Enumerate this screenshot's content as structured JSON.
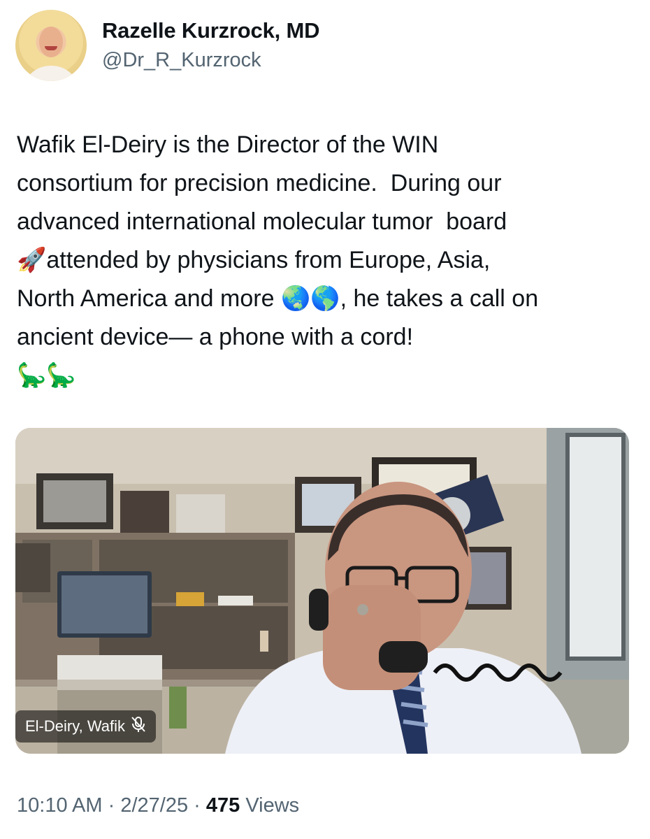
{
  "author": {
    "display_name": "Razelle Kurzrock, MD",
    "handle": "@Dr_R_Kurzrock",
    "avatar_icon": "profile-photo"
  },
  "tweet": {
    "line1": "Wafik El-Deiry is the Director of the WIN",
    "line2": "consortium for precision medicine.  During our",
    "line3": "advanced international molecular tumor  board",
    "line4_emoji": "🚀",
    "line4": "attended by physicians from Europe, Asia,",
    "line5a": "North America and more",
    "line5_emoji": "🌏🌎",
    "line5b": ", he takes a call on",
    "line6": "ancient device— a phone with a cord!",
    "line7_emoji": "🦕🦕"
  },
  "media": {
    "participant_label": "El-Deiry, Wafik",
    "muted_icon": "mic-off-icon"
  },
  "footer": {
    "time": "10:10 AM",
    "separator": "·",
    "date": "2/27/25",
    "views_count": "475",
    "views_label": "Views"
  }
}
